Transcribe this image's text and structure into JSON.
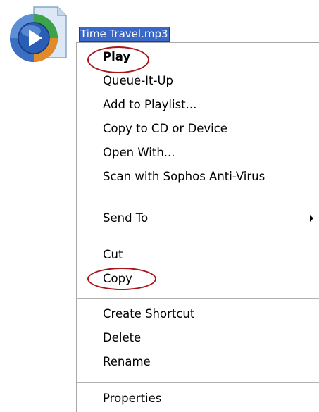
{
  "file": {
    "name": "Time Travel.mp3",
    "icon": "windows-media-player-icon"
  },
  "context_menu": {
    "groups": [
      [
        {
          "label": "Play",
          "bold": true,
          "annotated": true
        },
        {
          "label": "Queue-It-Up"
        },
        {
          "label": "Add to Playlist..."
        },
        {
          "label": "Copy to CD or Device"
        },
        {
          "label": "Open With..."
        },
        {
          "label": "Scan with Sophos Anti-Virus"
        }
      ],
      [
        {
          "label": "Send To",
          "submenu": true
        }
      ],
      [
        {
          "label": "Cut"
        },
        {
          "label": "Copy",
          "annotated": true
        }
      ],
      [
        {
          "label": "Create Shortcut"
        },
        {
          "label": "Delete"
        },
        {
          "label": "Rename"
        }
      ],
      [
        {
          "label": "Properties"
        }
      ]
    ]
  },
  "colors": {
    "selection": "#3a68c8",
    "annotation": "#a8161b",
    "menu_border": "#a8a8a8",
    "separator": "#b3b3b3"
  }
}
